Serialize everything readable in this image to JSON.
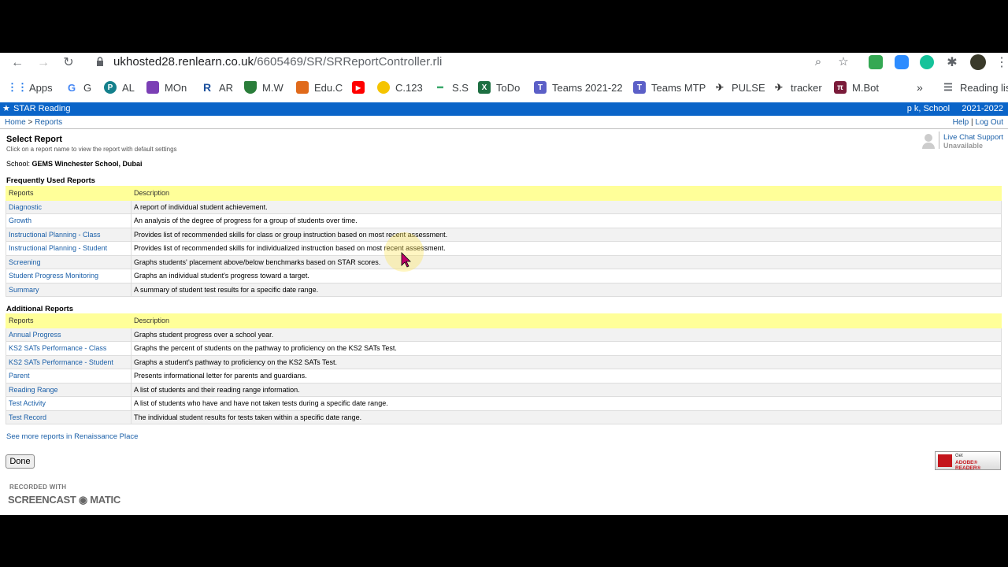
{
  "browser": {
    "url_host": "ukhosted28.renlearn.co.uk",
    "url_path": "/6605469/SR/SRReportController.rli",
    "bookmarks": [
      {
        "label": "Apps",
        "icon": "apps-grid-icon"
      },
      {
        "label": "G",
        "icon": "google-icon"
      },
      {
        "label": "AL",
        "icon": "p-circle-icon"
      },
      {
        "label": "MOn",
        "icon": "purple-book-icon"
      },
      {
        "label": "AR",
        "icon": "r-logo-icon"
      },
      {
        "label": "M.W",
        "icon": "shield-icon"
      },
      {
        "label": "Edu.C",
        "icon": "orange-square-icon"
      },
      {
        "label": "",
        "icon": "youtube-icon"
      },
      {
        "label": "C.123",
        "icon": "smiley-icon"
      },
      {
        "label": "S.S",
        "icon": "dumbbell-icon"
      },
      {
        "label": "ToDo",
        "icon": "excel-icon"
      },
      {
        "label": "Teams 2021-22",
        "icon": "teams-icon"
      },
      {
        "label": "Teams MTP",
        "icon": "teams-icon"
      },
      {
        "label": "PULSE",
        "icon": "pulse-icon"
      },
      {
        "label": "tracker",
        "icon": "tracker-icon"
      },
      {
        "label": "M.Bot",
        "icon": "pi-icon"
      }
    ],
    "overflow": "»",
    "reading_list": "Reading list"
  },
  "app": {
    "name": "STAR Reading",
    "user_info": "p k, School     2021-2022",
    "breadcrumb_home": "Home",
    "breadcrumb_sep": " > ",
    "breadcrumb_current": "Reports",
    "help": "Help",
    "link_sep": " | ",
    "logout": "Log Out"
  },
  "page": {
    "title": "Select Report",
    "subtitle": "Click on a report name to view the report with default settings",
    "school_label": "School: ",
    "school_name": "GEMS Winchester School, Dubai",
    "chat_label": "Live Chat Support",
    "chat_status": "Unavailable",
    "more_link": "See more reports in Renaissance Place",
    "done": "Done",
    "adobe_line1": "Get",
    "adobe_line2": "ADOBE® READER®",
    "watermark_top": "RECORDED WITH",
    "watermark_brand": "SCREENCAST ◉ MATIC"
  },
  "frequent": {
    "title": "Frequently Used Reports",
    "col_reports": "Reports",
    "col_description": "Description",
    "rows": [
      {
        "name": "Diagnostic",
        "desc": "A report of individual student achievement."
      },
      {
        "name": "Growth",
        "desc": "An analysis of the degree of progress for a group of students over time."
      },
      {
        "name": "Instructional Planning - Class",
        "desc": "Provides list of recommended skills for class or group instruction based on most recent assessment."
      },
      {
        "name": "Instructional Planning - Student",
        "desc": "Provides list of recommended skills for individualized instruction based on most recent assessment."
      },
      {
        "name": "Screening",
        "desc": "Graphs students' placement above/below benchmarks based on STAR scores."
      },
      {
        "name": "Student Progress Monitoring",
        "desc": "Graphs an individual student's progress toward a target."
      },
      {
        "name": "Summary",
        "desc": "A summary of student test results for a specific date range."
      }
    ]
  },
  "additional": {
    "title": "Additional Reports",
    "col_reports": "Reports",
    "col_description": "Description",
    "rows": [
      {
        "name": "Annual Progress",
        "desc": "Graphs student progress over a school year."
      },
      {
        "name": "KS2 SATs Performance - Class",
        "desc": "Graphs the percent of students on the pathway to proficiency on the KS2 SATs Test."
      },
      {
        "name": "KS2 SATs Performance - Student",
        "desc": "Graphs a student's pathway to proficiency on the KS2 SATs Test."
      },
      {
        "name": "Parent",
        "desc": "Presents informational letter for parents and guardians."
      },
      {
        "name": "Reading Range",
        "desc": "A list of students and their reading range information."
      },
      {
        "name": "Test Activity",
        "desc": "A list of students who have and have not taken tests during a specific date range."
      },
      {
        "name": "Test Record",
        "desc": "The individual student results for tests taken within a specific date range."
      }
    ]
  },
  "colors": {
    "appbar": "#0a64c8",
    "table_header": "#ffff99",
    "link": "#1a5fa8"
  }
}
